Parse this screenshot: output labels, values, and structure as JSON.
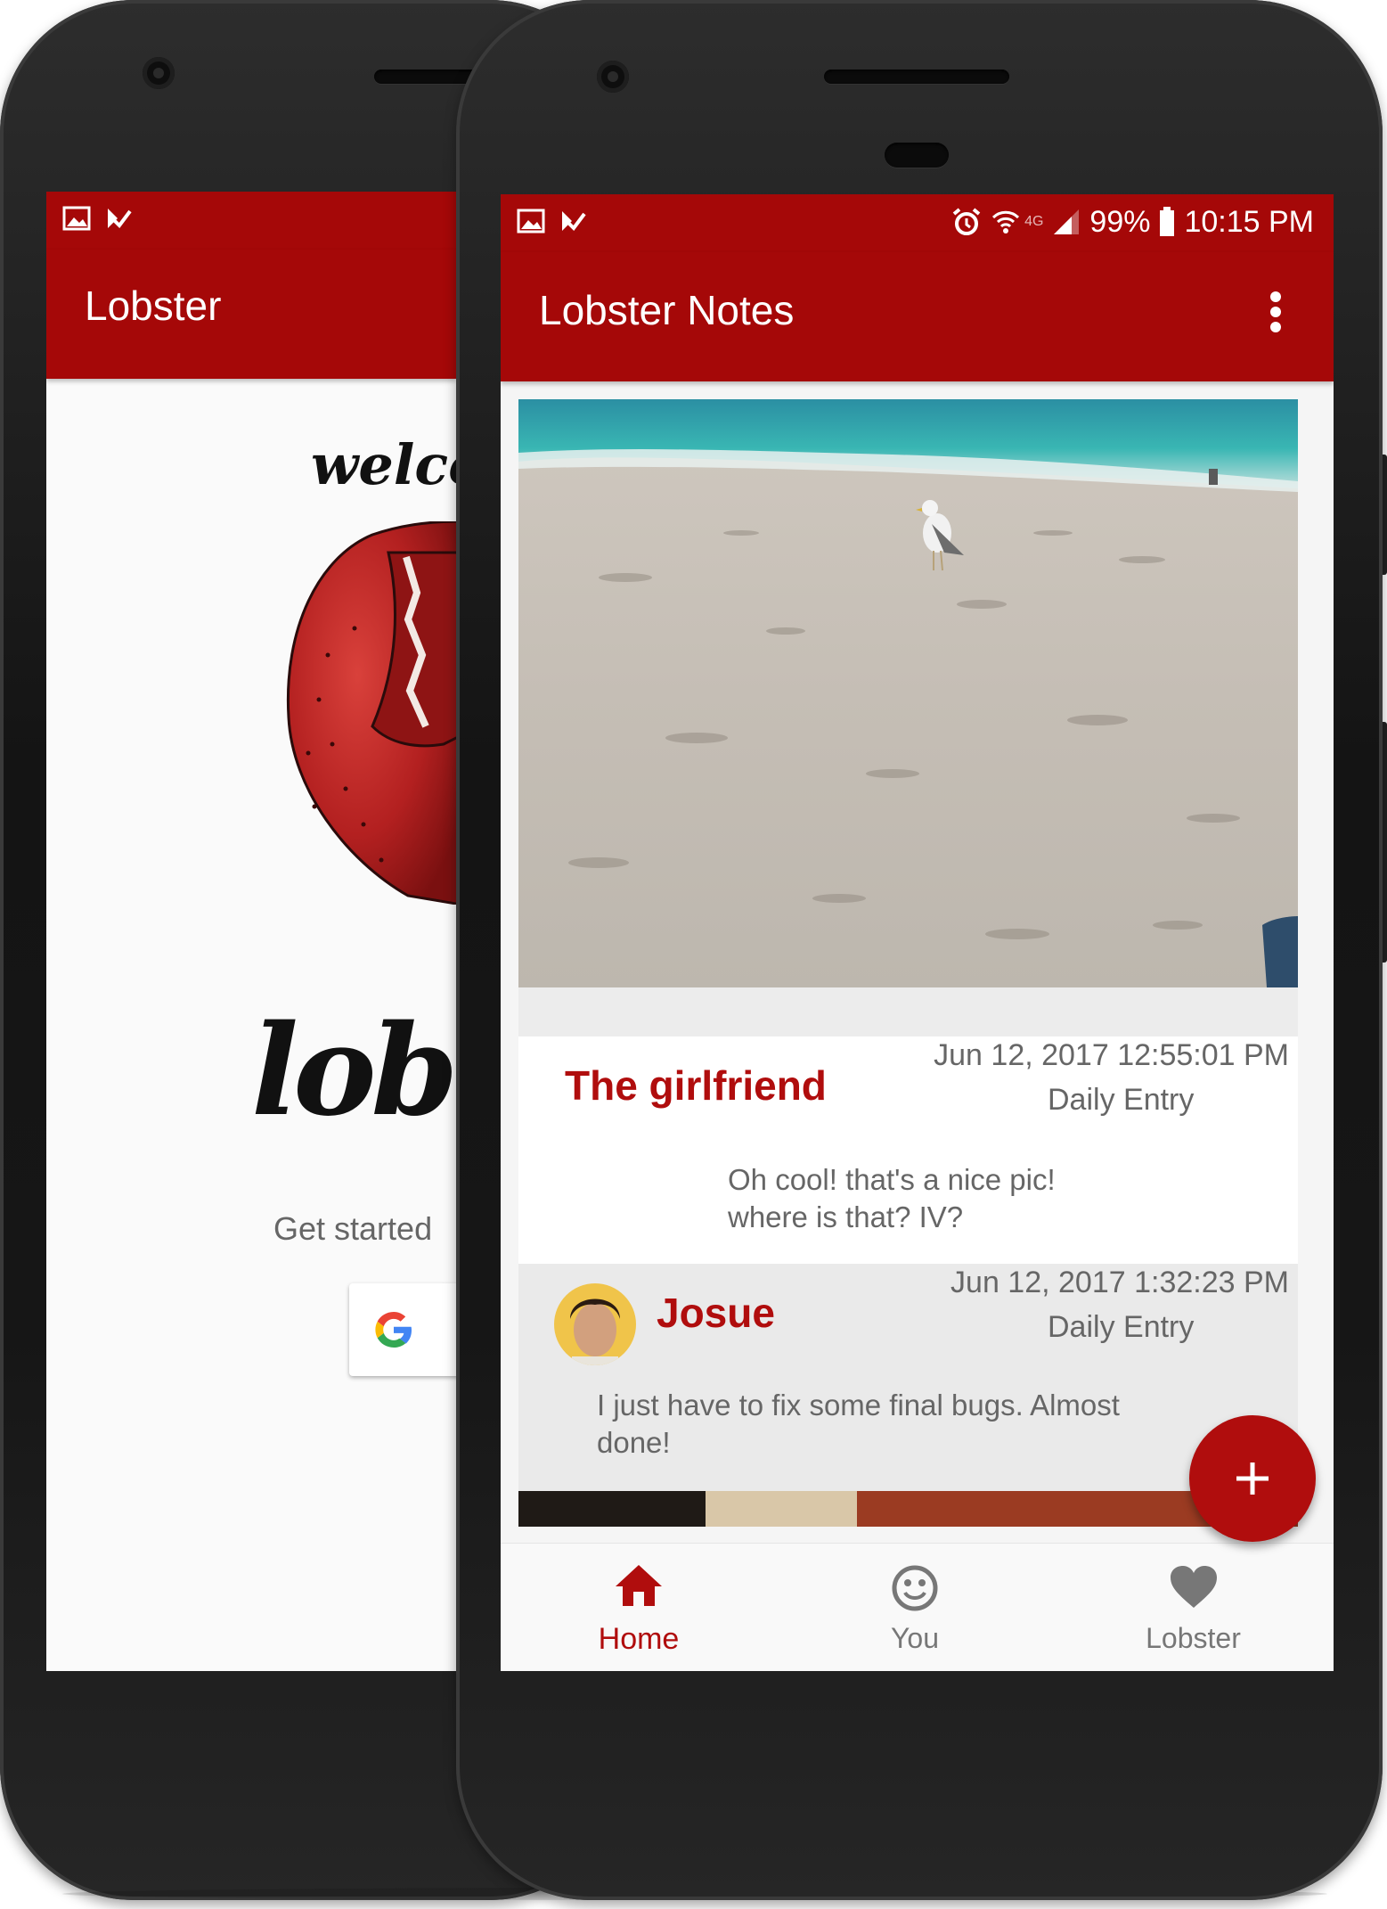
{
  "left_app": {
    "title": "Lobster",
    "welcome_text": "welco",
    "logo_text": "lob",
    "get_started": "Get started"
  },
  "right_app": {
    "status": {
      "battery": "99%",
      "time": "10:15 PM",
      "network": "4G"
    },
    "title": "Lobster Notes",
    "comments": [
      {
        "author": "The girlfriend",
        "date": "Jun 12, 2017 12:55:01 PM",
        "entry_type": "Daily Entry",
        "text_line1": "Oh cool! that's a nice pic!",
        "text_line2": "where is that? IV?"
      },
      {
        "author": "Josue",
        "date": "Jun 12, 2017 1:32:23 PM",
        "entry_type": "Daily Entry",
        "text_line1": "I just have to fix some final bugs. Almost",
        "text_line2": "done!"
      }
    ],
    "nav": {
      "home": "Home",
      "you": "You",
      "lobster": "Lobster"
    }
  },
  "colors": {
    "brand_red": "#a50808",
    "accent_red": "#b00d0d"
  }
}
